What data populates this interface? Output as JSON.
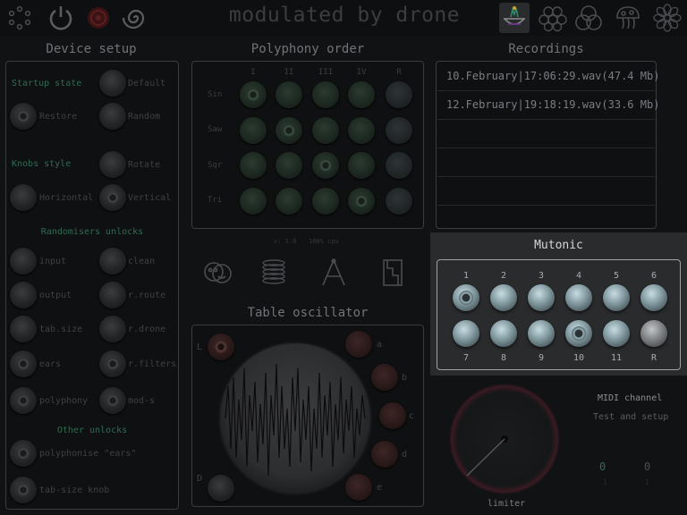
{
  "app_title": "modulated by drone",
  "top_icons": [
    "dots-circle-icon",
    "power-icon",
    "record-icon",
    "spiral-icon",
    "drone-icon",
    "cluster-icon",
    "three-circles-icon",
    "mushroom-icon",
    "flower-icon"
  ],
  "device_setup": {
    "title": "Device setup",
    "startup_state_label": "Startup state",
    "default_label": "Default",
    "restore_label": "Restore",
    "random_label": "Random",
    "knobs_style_label": "Knobs style",
    "rotate_label": "Rotate",
    "horizontal_label": "Horizontal",
    "vertical_label": "Vertical",
    "randomisers_title": "Randomisers unlocks",
    "randomisers": [
      "input",
      "clean",
      "output",
      "r.route",
      "tab.size",
      "r.drone",
      "ears",
      "r.filters",
      "polyphony",
      "mod-s"
    ],
    "other_title": "Other unlocks",
    "other": [
      "polyphonise \"ears\"",
      "tab-size knob"
    ]
  },
  "polyphony": {
    "title": "Polyphony order",
    "columns": [
      "I",
      "II",
      "III",
      "IV",
      "R"
    ],
    "rows": [
      "Sin",
      "Saw",
      "Sqr",
      "Tri"
    ],
    "version": "v: 1.0",
    "cpu": "100% cpu"
  },
  "mode_icons": [
    "masks-icon",
    "coil-icon",
    "compass-icon",
    "pillar-icon"
  ],
  "table_oscillator": {
    "title": "Table oscillator",
    "left_labels": [
      "L",
      "D"
    ],
    "right_labels": [
      "a",
      "b",
      "c",
      "d",
      "e"
    ]
  },
  "recordings": {
    "title": "Recordings",
    "items": [
      "10.February|17:06:29.wav(47.4 Mb)",
      "12.February|19:18:19.wav(33.6 Mb)"
    ]
  },
  "mutonic": {
    "title": "Mutonic",
    "top_numbers": [
      "1",
      "2",
      "3",
      "4",
      "5",
      "6"
    ],
    "bottom_numbers": [
      "7",
      "8",
      "9",
      "10",
      "11",
      "R"
    ]
  },
  "limiter": {
    "label": "limiter"
  },
  "midi": {
    "channel_label": "MIDI channel",
    "test_label": "Test and setup",
    "values": [
      "0",
      "0"
    ],
    "sub_values": [
      "1",
      "1"
    ]
  },
  "colors": {
    "accent_green": "#2f6b52",
    "knob_red": "#3d2626",
    "mutonic_knob": "#8aa3a9",
    "background": "#111214"
  }
}
